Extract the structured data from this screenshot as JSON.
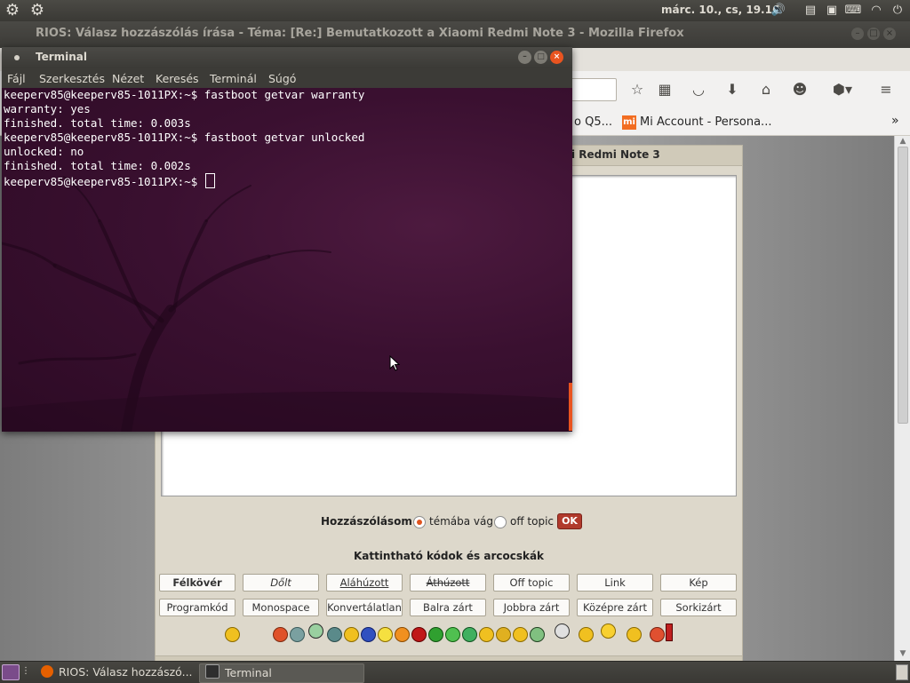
{
  "top_panel": {
    "clock": "márc. 10., cs, 19.16",
    "tray_icons": [
      "volume-icon",
      "clipboard-icon",
      "network-applet-icon",
      "keyboard-icon",
      "wifi-icon",
      "power-icon"
    ]
  },
  "firefox": {
    "window_title": "RIOS: Válasz hozzászólás írása - Téma: [Re:] Bemutatkozott a Xiaomi Redmi Note 3 - Mozilla Firefox",
    "bookmarks": {
      "partial": "o Q5...",
      "mi_logo": "mi",
      "mi_account": "Mi Account - Persona...",
      "overflow": "»"
    },
    "form": {
      "heading": "i Redmi Note 3",
      "topic_label": "Hozzászólásom",
      "option_on_topic": "témába vág",
      "option_off_topic": "off topic",
      "ok_label": "OK",
      "codes_title": "Kattintható kódok és arcocskák",
      "format_row1": [
        "Félkövér",
        "Dőlt",
        "Aláhúzott",
        "Áthúzott",
        "Off topic",
        "Link",
        "Kép"
      ],
      "format_row2": [
        "Programkód",
        "Monospace",
        "Konvertálatlan",
        "Balra zárt",
        "Jobbra zárt",
        "Középre zárt",
        "Sorkizárt"
      ]
    }
  },
  "terminal": {
    "title": "Terminal",
    "menu": [
      "Fájl",
      "Szerkesztés",
      "Nézet",
      "Keresés",
      "Terminál",
      "Súgó"
    ],
    "lines": [
      "keeperv85@keeperv85-1011PX:~$ fastboot getvar warranty",
      "warranty: yes",
      "finished. total time: 0.003s",
      "keeperv85@keeperv85-1011PX:~$ fastboot getvar unlocked",
      "unlocked: no",
      "finished. total time: 0.002s"
    ],
    "prompt": "keeperv85@keeperv85-1011PX:~$ "
  },
  "taskbar": {
    "firefox_task": "RIOS: Válasz hozzászó...",
    "terminal_task": "Terminal"
  },
  "colors": {
    "terminal_bg": "#2b0d22",
    "ubuntu_orange": "#e95420",
    "panel": "#3c3b37",
    "ok_button": "#b13a2c"
  }
}
